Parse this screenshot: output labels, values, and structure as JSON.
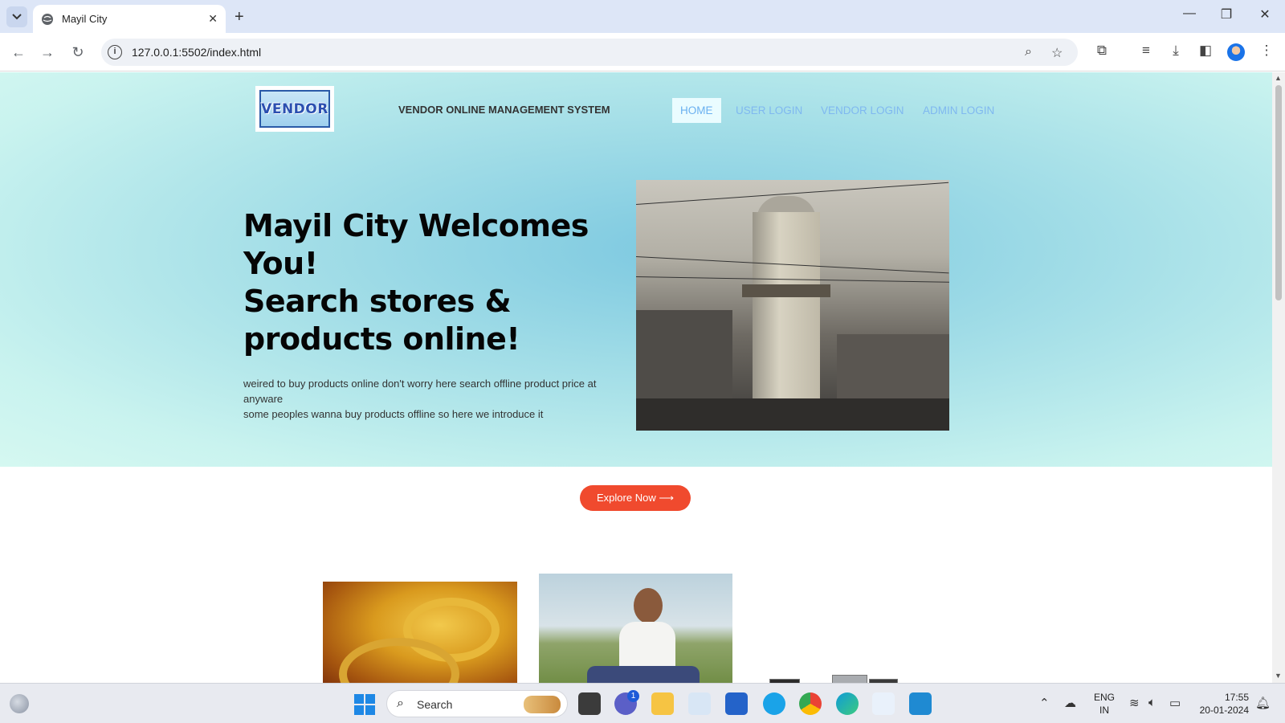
{
  "browser": {
    "tab_title": "Mayil City",
    "url": "127.0.0.1:5502/index.html"
  },
  "site": {
    "logo_text": "VENDOR",
    "title": "VENDOR ONLINE MANAGEMENT SYSTEM",
    "nav": [
      {
        "label": "HOME",
        "active": true
      },
      {
        "label": "USER LOGIN",
        "active": false
      },
      {
        "label": "VENDOR LOGIN",
        "active": false
      },
      {
        "label": "ADMIN LOGIN",
        "active": false
      }
    ],
    "hero": {
      "heading_line1": "Mayil City Welcomes",
      "heading_line2": "You!",
      "heading_line3": "Search stores &",
      "heading_line4": "products online!",
      "desc_line1": "weired to buy products online don't worry here search offline product price at anyware",
      "desc_line2": "some peoples wanna buy products offline so here we introduce it"
    },
    "explore_button": "Explore Now ⟶"
  },
  "taskbar": {
    "search_label": "Search",
    "chat_badge": "1",
    "lang_line1": "ENG",
    "lang_line2": "IN",
    "time": "17:55",
    "date": "20-01-2024"
  },
  "colors": {
    "accent_button": "#f04a2e",
    "nav_link": "#7fb8f0",
    "hero_bg": "#a7e0e8"
  }
}
